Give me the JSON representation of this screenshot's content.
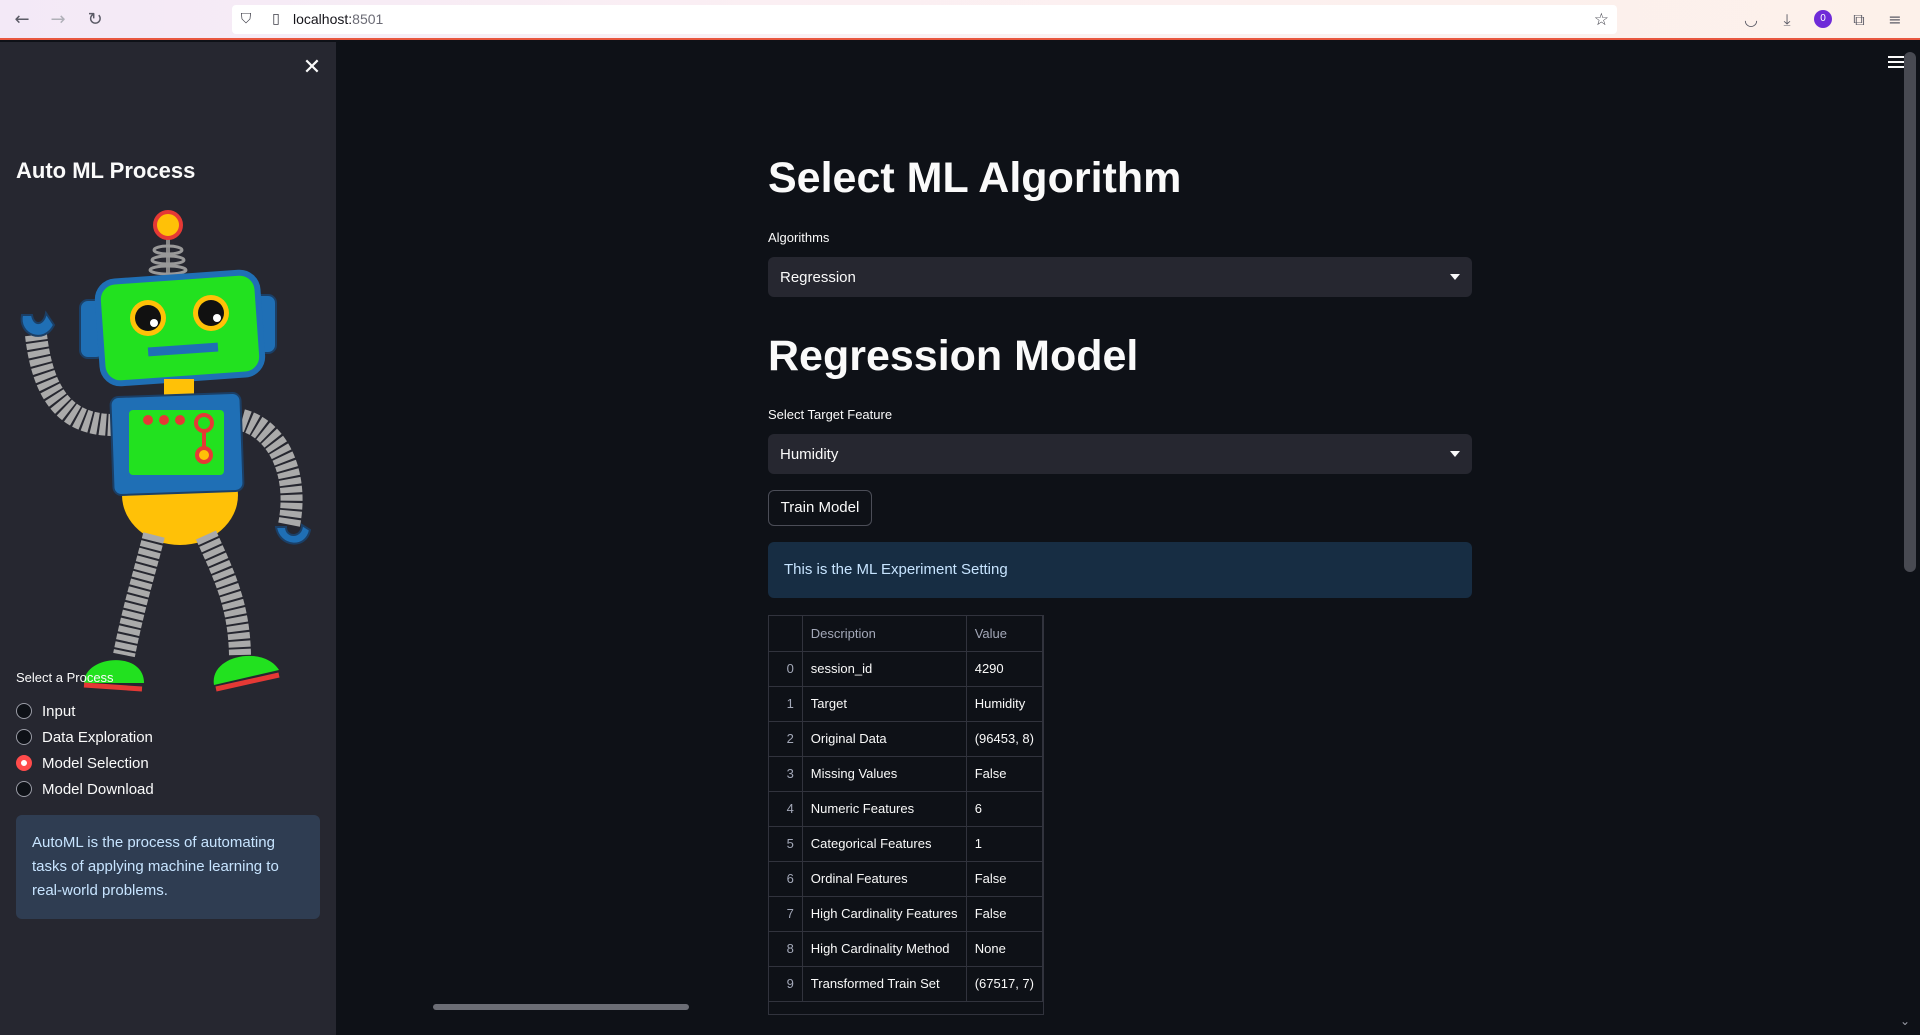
{
  "browser": {
    "url_host": "localhost:",
    "url_port": "8501",
    "profile_initial": "0"
  },
  "sidebar": {
    "title": "Auto ML Process",
    "process_label": "Select a Process",
    "processes": [
      {
        "label": "Input",
        "selected": false
      },
      {
        "label": "Data Exploration",
        "selected": false
      },
      {
        "label": "Model Selection",
        "selected": true
      },
      {
        "label": "Model Download",
        "selected": false
      }
    ],
    "info": "AutoML is the process of automating tasks of applying machine learning to real-world problems."
  },
  "main": {
    "title": "Select ML Algorithm",
    "algorithms_label": "Algorithms",
    "algorithms_value": "Regression",
    "subtitle": "Regression Model",
    "target_label": "Select Target Feature",
    "target_value": "Humidity",
    "train_button": "Train Model",
    "info": "This is the ML Experiment Setting",
    "table": {
      "columns": [
        "Description",
        "Value"
      ],
      "rows": [
        {
          "idx": "0",
          "desc": "session_id",
          "val": "4290"
        },
        {
          "idx": "1",
          "desc": "Target",
          "val": "Humidity"
        },
        {
          "idx": "2",
          "desc": "Original Data",
          "val": "(96453, 8)"
        },
        {
          "idx": "3",
          "desc": "Missing Values",
          "val": "False"
        },
        {
          "idx": "4",
          "desc": "Numeric Features",
          "val": "6"
        },
        {
          "idx": "5",
          "desc": "Categorical Features",
          "val": "1"
        },
        {
          "idx": "6",
          "desc": "Ordinal Features",
          "val": "False"
        },
        {
          "idx": "7",
          "desc": "High Cardinality Features",
          "val": "False"
        },
        {
          "idx": "8",
          "desc": "High Cardinality Method",
          "val": "None"
        },
        {
          "idx": "9",
          "desc": "Transformed Train Set",
          "val": "(67517, 7)"
        }
      ]
    }
  },
  "colors": {
    "accent": "#ff4b4b",
    "background": "#0e1117",
    "sidebar": "#262730",
    "info_bg": "#172d43"
  }
}
